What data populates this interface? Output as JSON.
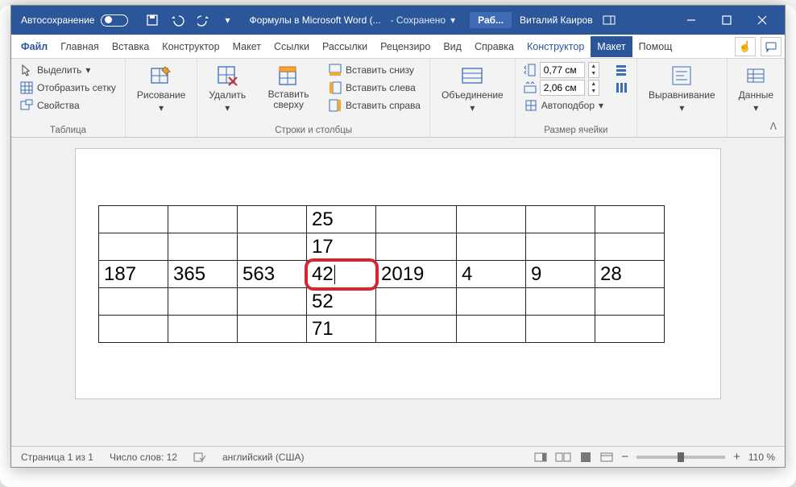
{
  "titlebar": {
    "autosave": "Автосохранение",
    "doc_title": "Формулы в Microsoft Word (...",
    "saved": "- Сохранено",
    "filename_short": "Раб...",
    "user": "Виталий Каиров"
  },
  "menus": {
    "file": "Файл",
    "home": "Главная",
    "insert": "Вставка",
    "design": "Конструктор",
    "layout": "Макет",
    "references": "Ссылки",
    "mailings": "Рассылки",
    "review": "Рецензиро",
    "view": "Вид",
    "help": "Справка",
    "ctx_design": "Конструктор",
    "ctx_layout": "Макет",
    "tell_me": "Помощ"
  },
  "ribbon": {
    "table": {
      "select": "Выделить",
      "gridlines": "Отобразить сетку",
      "properties": "Свойства",
      "label": "Таблица"
    },
    "draw": {
      "label": "Рисование"
    },
    "delete": {
      "label": "Удалить"
    },
    "insert": {
      "above": "Вставить сверху",
      "below": "Вставить снизу",
      "left": "Вставить слева",
      "right": "Вставить справа",
      "label": "Строки и столбцы"
    },
    "merge": {
      "label": "Объединение"
    },
    "cellsize": {
      "height": "0,77 см",
      "width": "2,06 см",
      "autofit": "Автоподбор",
      "label": "Размер ячейки"
    },
    "align": {
      "label": "Выравнивание"
    },
    "data": {
      "label": "Данные"
    }
  },
  "table": {
    "rows": [
      [
        "",
        "",
        "",
        "25",
        "",
        "",
        "",
        ""
      ],
      [
        "",
        "",
        "",
        "17",
        "",
        "",
        "",
        ""
      ],
      [
        "187",
        "365",
        "563",
        "42",
        "2019",
        "4",
        "9",
        "28"
      ],
      [
        "",
        "",
        "",
        "52",
        "",
        "",
        "",
        ""
      ],
      [
        "",
        "",
        "",
        "71",
        "",
        "",
        "",
        ""
      ]
    ],
    "highlight": {
      "row": 2,
      "col": 3
    }
  },
  "status": {
    "page": "Страница 1 из 1",
    "words": "Число слов: 12",
    "lang": "английский (США)",
    "zoom": "110 %"
  }
}
